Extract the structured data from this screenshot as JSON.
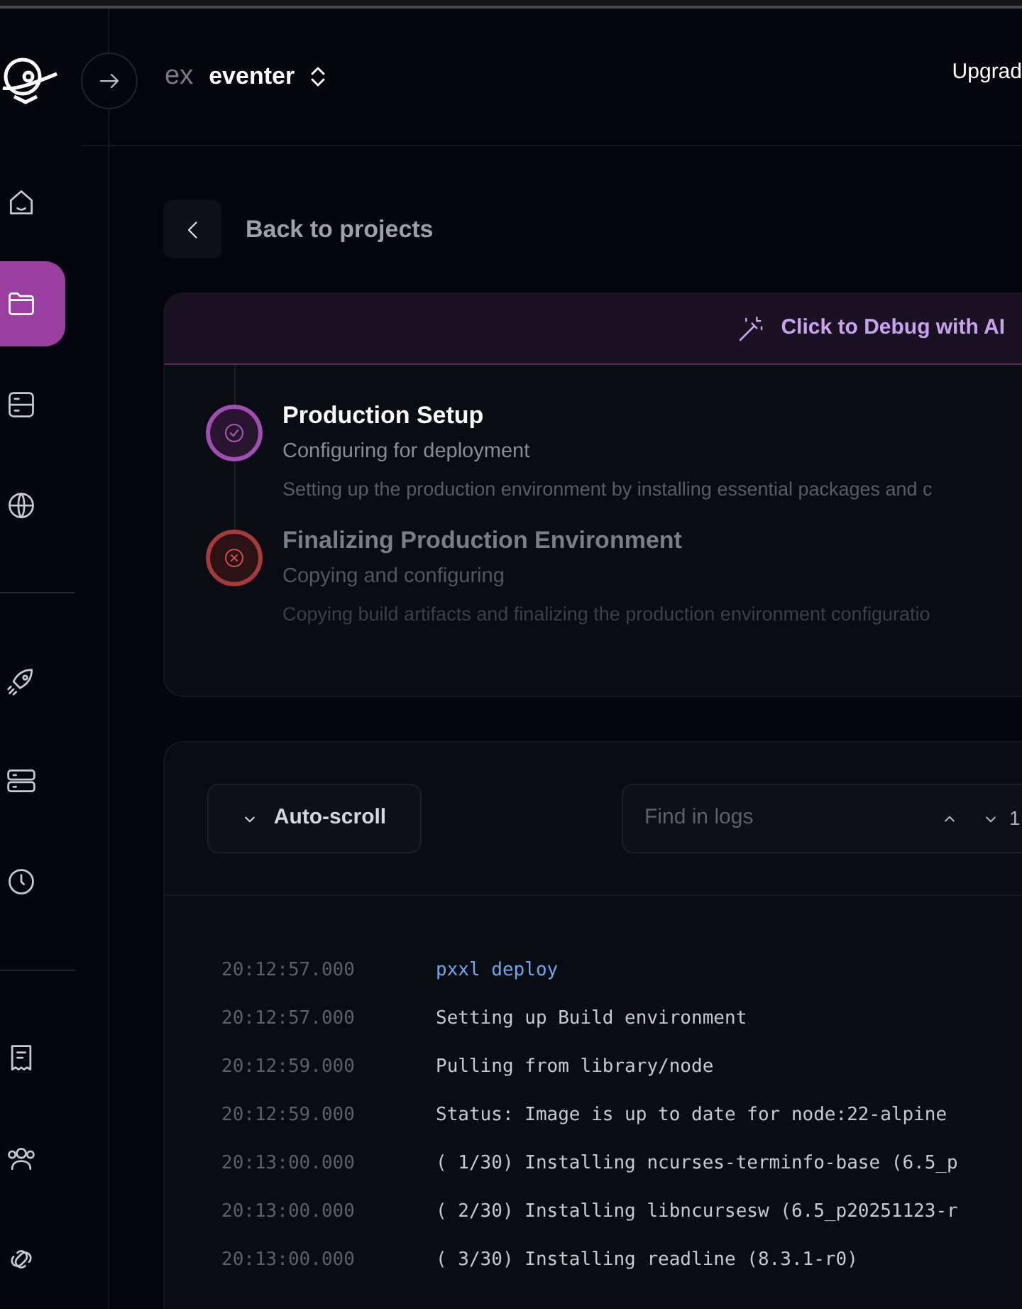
{
  "sidebar": {
    "items": [
      {
        "kind": "home",
        "selected": false
      },
      {
        "kind": "folder",
        "selected": true
      },
      {
        "kind": "storage",
        "selected": false
      },
      {
        "kind": "globe",
        "selected": false
      },
      {
        "kind": "divider"
      },
      {
        "kind": "rocket",
        "selected": false
      },
      {
        "kind": "servers",
        "selected": false
      },
      {
        "kind": "clock",
        "selected": false
      },
      {
        "kind": "divider"
      },
      {
        "kind": "receipt",
        "selected": false
      },
      {
        "kind": "users",
        "selected": false
      },
      {
        "kind": "link",
        "selected": false
      }
    ]
  },
  "header": {
    "org_badge": "ex",
    "project": "eventer",
    "upgrade": "Upgrad"
  },
  "back": {
    "label": "Back to projects"
  },
  "steps": {
    "debug_button": "Click to Debug with AI",
    "items": [
      {
        "title": "Production Setup",
        "subtitle": "Configuring for deployment",
        "description": "Setting up the production environment by installing essential packages and c",
        "kind": "success"
      },
      {
        "title": "Finalizing Production Environment",
        "subtitle": "Copying and configuring",
        "description": "Copying build artifacts and finalizing the production environment configuratio",
        "kind": "failed"
      }
    ]
  },
  "logs": {
    "auto_scroll": "Auto-scroll",
    "search": {
      "placeholder": "Find in logs",
      "count": "1"
    },
    "rows": [
      {
        "time": "20:12:57.000",
        "text": "pxxl deploy",
        "kind": "command"
      },
      {
        "time": "20:12:57.000",
        "text": "Setting up Build environment",
        "kind": "output"
      },
      {
        "time": "20:12:59.000",
        "text": "Pulling from library/node",
        "kind": "output"
      },
      {
        "time": "20:12:59.000",
        "text": "Status: Image is up to date for node:22-alpine",
        "kind": "output"
      },
      {
        "time": "20:13:00.000",
        "text": "( 1/30) Installing ncurses-terminfo-base (6.5_p",
        "kind": "output"
      },
      {
        "time": "20:13:00.000",
        "text": "( 2/30) Installing libncursesw (6.5_p20251123-r",
        "kind": "output"
      },
      {
        "time": "20:13:00.000",
        "text": "( 3/30) Installing readline (8.3.1-r0)",
        "kind": "output"
      }
    ]
  }
}
